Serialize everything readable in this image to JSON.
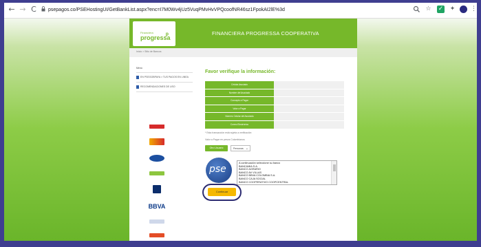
{
  "browser": {
    "url": "psepagos.co/PSEHostingUI/GetBankList.aspx?enc=I7M0Wv4jUz5VuqPMvHvVPQcoofNR46sz1FpokAI2lE%3d",
    "back": "←",
    "forward": "→",
    "reload": "C",
    "zoom_icon": "search-icon",
    "star": "☆",
    "ext1": "✓",
    "ext2": "✦",
    "menu": "⋮"
  },
  "banner": {
    "logo_small": "Financiera",
    "logo_big": "progressa",
    "title": "FINANCIERA PROGRESSA COOPERATIVA"
  },
  "breadcrumb": "Inicio > Sitio de Bancos",
  "sidebar": {
    "title": "Menú",
    "items": [
      {
        "label": "EN PSEGOBPAYA > TUS PAGOS EN LINEA"
      },
      {
        "label": "RECOMENDACIONES DE USO"
      }
    ]
  },
  "form": {
    "title": "Favor verifique la información:",
    "rows": [
      {
        "label": "Cédula Asociado",
        "value": ""
      },
      {
        "label": "Nombre del Asociado",
        "value": ""
      },
      {
        "label": "Concepto a Pagar",
        "value": ""
      },
      {
        "label": "Valor a Pagar",
        "value": ""
      },
      {
        "label": "Número Celular del Asociado",
        "value": ""
      },
      {
        "label": "Correo Electrónico",
        "value": ""
      }
    ],
    "note1": "* Esta transacción está sujeta a verificación",
    "note2": "Valor a Pagar en pesos Colombianos",
    "green_button": "Otro Usuario",
    "small_select": "Personas"
  },
  "bank_select": {
    "options": [
      "A continuación seleccione su banco",
      "BANCAMIA S.A.",
      "BANCO AGRARIO",
      "BANCO AV VILLAS",
      "BANCO BBVA COLOMBIA S.A.",
      "BANCO CAJA SOCIAL",
      "BANCO COOPERATIVO COOPCENTRAL"
    ]
  },
  "pse_logo": "pse",
  "continue_label": "Continuar",
  "bank_logo_text": "BBVA",
  "colors": {
    "brand_green": "#76b82a",
    "continue_yellow": "#f5b800",
    "ring": "#2b2a70"
  }
}
